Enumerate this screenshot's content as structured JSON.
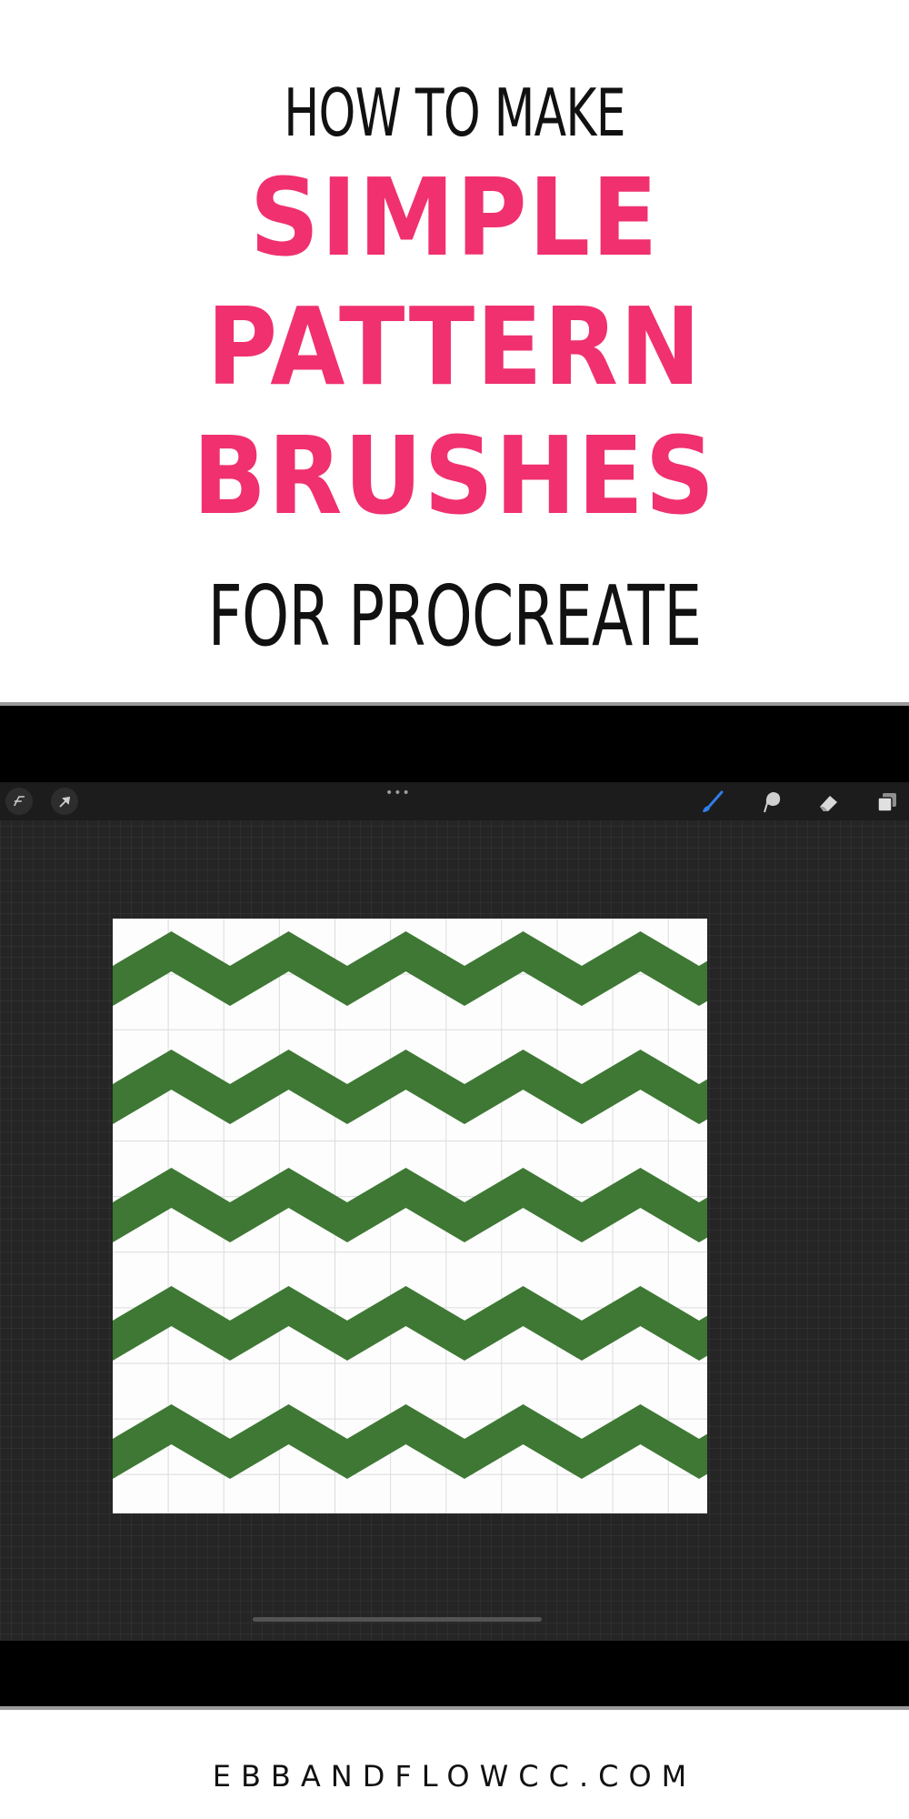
{
  "title": {
    "line1": "HOW TO MAKE",
    "line2": "SIMPLE",
    "line3": "PATTERN",
    "line4": "BRUSHES",
    "line5": "FOR PROCREATE",
    "accent_color": "#f0306f",
    "text_color": "#111111"
  },
  "app": {
    "toolbar": {
      "left_tools": [
        "modify-tool",
        "selection-tool"
      ],
      "actions_menu": "more-actions",
      "right_tools": [
        "brush-tool",
        "smudge-tool",
        "eraser-tool",
        "layers-tool"
      ],
      "active_tool_color": "#2f7de8"
    },
    "canvas": {
      "pattern": "zigzag",
      "rows": 5,
      "stroke_color": "#3e7834",
      "background_color": "#fdfdfd"
    }
  },
  "footer": {
    "url": "EBBANDFLOWCC.COM"
  }
}
